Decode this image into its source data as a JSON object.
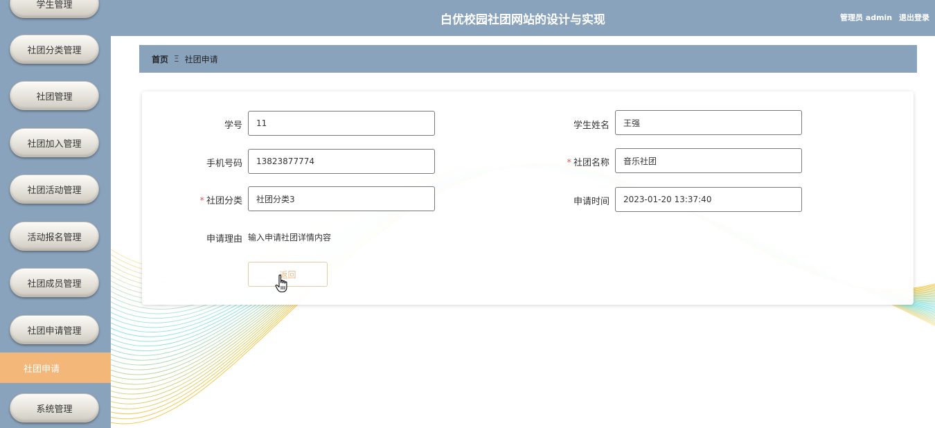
{
  "header": {
    "title": "白优校园社团网站的设计与实现",
    "user_label": "管理员 admin",
    "logout_label": "退出登录"
  },
  "sidebar": {
    "items": [
      {
        "label": "学生管理"
      },
      {
        "label": "社团分类管理"
      },
      {
        "label": "社团管理"
      },
      {
        "label": "社团加入管理"
      },
      {
        "label": "社团活动管理"
      },
      {
        "label": "活动报名管理"
      },
      {
        "label": "社团成员管理"
      },
      {
        "label": "社团申请管理"
      },
      {
        "label": "社团申请",
        "active": true
      },
      {
        "label": "系统管理"
      }
    ]
  },
  "breadcrumb": {
    "home": "首页",
    "separator": "Ξ",
    "current": "社团申请"
  },
  "form": {
    "student_id": {
      "label": "学号",
      "value": "11"
    },
    "student_name": {
      "label": "学生姓名",
      "value": "王强"
    },
    "phone": {
      "label": "手机号码",
      "value": "13823877774"
    },
    "club_name": {
      "label": "社团名称",
      "value": "音乐社团",
      "required": true
    },
    "club_category": {
      "label": "社团分类",
      "value": "社团分类3",
      "required": true
    },
    "apply_time": {
      "label": "申请时间",
      "value": "2023-01-20 13:37:40"
    },
    "reason": {
      "label": "申请理由",
      "value": "输入申请社团详情内容"
    },
    "back_label": "返回",
    "required_mark": "*"
  },
  "colors": {
    "primary": "#8aa3bd",
    "active": "#f2b779",
    "required": "#e05a5a"
  }
}
